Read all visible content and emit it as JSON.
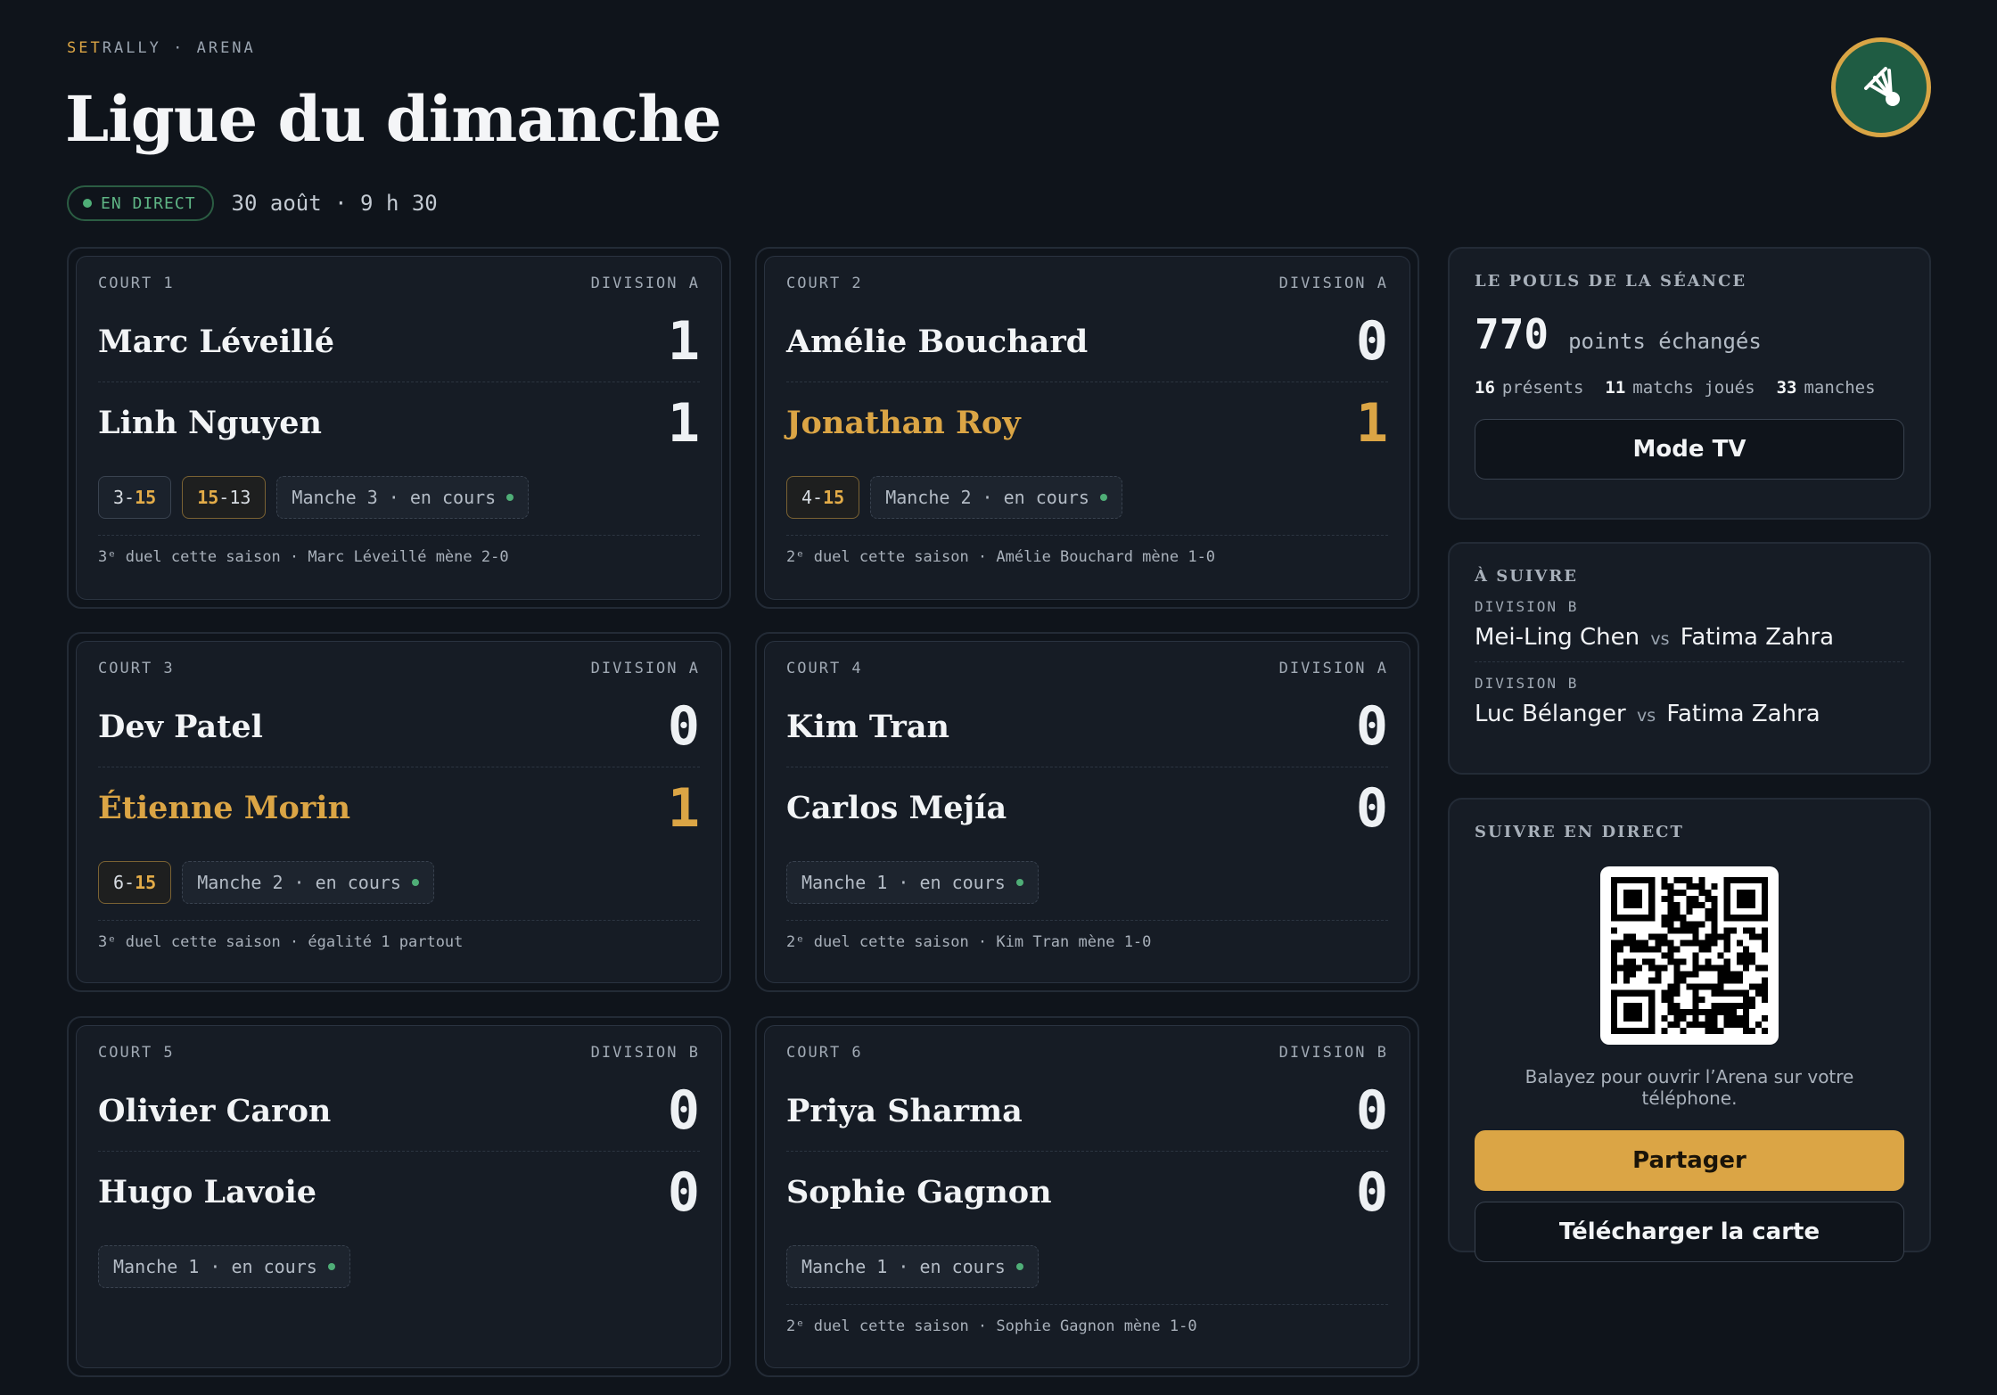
{
  "header": {
    "brand_accent": "SET",
    "brand_rest": "RALLY · ARENA",
    "title": "Ligue du dimanche",
    "live_label": "EN DIRECT",
    "date": "30 août · 9 h 30"
  },
  "logo": {
    "icon": "shuttlecock-icon"
  },
  "colors": {
    "accent": "#dba545",
    "live": "#4fae77",
    "background": "#0f141b"
  },
  "courts": [
    {
      "court": "COURT 1",
      "division": "DIVISION A",
      "p1": {
        "name": "Marc Léveillé",
        "score": "1"
      },
      "p2": {
        "name": "Linh Nguyen",
        "score": "1"
      },
      "sets": [
        {
          "a": "3-",
          "b": "15"
        },
        {
          "a": "15",
          "b": "-13"
        }
      ],
      "status": "Manche 3 · en cours",
      "footer": "3ᵉ duel cette saison · Marc Léveillé mène 2-0"
    },
    {
      "court": "COURT 2",
      "division": "DIVISION A",
      "p1": {
        "name": "Amélie Bouchard",
        "score": "0"
      },
      "p2": {
        "name": "Jonathan Roy",
        "score": "1"
      },
      "sets": [
        {
          "a": "4-",
          "b": "15"
        }
      ],
      "status": "Manche 2 · en cours",
      "footer": "2ᵉ duel cette saison · Amélie Bouchard mène 1-0"
    },
    {
      "court": "COURT 3",
      "division": "DIVISION A",
      "p1": {
        "name": "Dev Patel",
        "score": "0"
      },
      "p2": {
        "name": "Étienne Morin",
        "score": "1"
      },
      "sets": [
        {
          "a": "6-",
          "b": "15"
        }
      ],
      "status": "Manche 2 · en cours",
      "footer": "3ᵉ duel cette saison · égalité 1 partout"
    },
    {
      "court": "COURT 4",
      "division": "DIVISION A",
      "p1": {
        "name": "Kim Tran",
        "score": "0"
      },
      "p2": {
        "name": "Carlos Mejía",
        "score": "0"
      },
      "status": "Manche 1 · en cours",
      "footer": "2ᵉ duel cette saison · Kim Tran mène 1-0"
    },
    {
      "court": "COURT 5",
      "division": "DIVISION B",
      "p1": {
        "name": "Olivier Caron",
        "score": "0"
      },
      "p2": {
        "name": "Hugo Lavoie",
        "score": "0"
      },
      "status": "Manche 1 · en cours"
    },
    {
      "court": "COURT 6",
      "division": "DIVISION B",
      "p1": {
        "name": "Priya Sharma",
        "score": "0"
      },
      "p2": {
        "name": "Sophie Gagnon",
        "score": "0"
      },
      "status": "Manche 1 · en cours",
      "footer": "2ᵉ duel cette saison · Sophie Gagnon mène 1-0"
    }
  ],
  "pulse": {
    "title": "LE POULS DE LA SÉANCE",
    "points": "770",
    "points_label": "points échangés",
    "present_n": "16",
    "present_label": "présents",
    "played_n": "11",
    "played_label": "matchs joués",
    "sets_n": "33",
    "sets_label": "manches",
    "tv_button": "Mode TV"
  },
  "next": {
    "title": "À SUIVRE",
    "vs": "vs",
    "items": [
      {
        "division": "DIVISION B",
        "a": "Mei-Ling Chen",
        "b": "Fatima Zahra"
      },
      {
        "division": "DIVISION B",
        "a": "Luc Bélanger",
        "b": "Fatima Zahra"
      }
    ]
  },
  "live": {
    "title": "SUIVRE EN DIRECT",
    "caption": "Balayez pour ouvrir l’Arena sur votre téléphone.",
    "share_button": "Partager",
    "download_button": "Télécharger la carte"
  }
}
